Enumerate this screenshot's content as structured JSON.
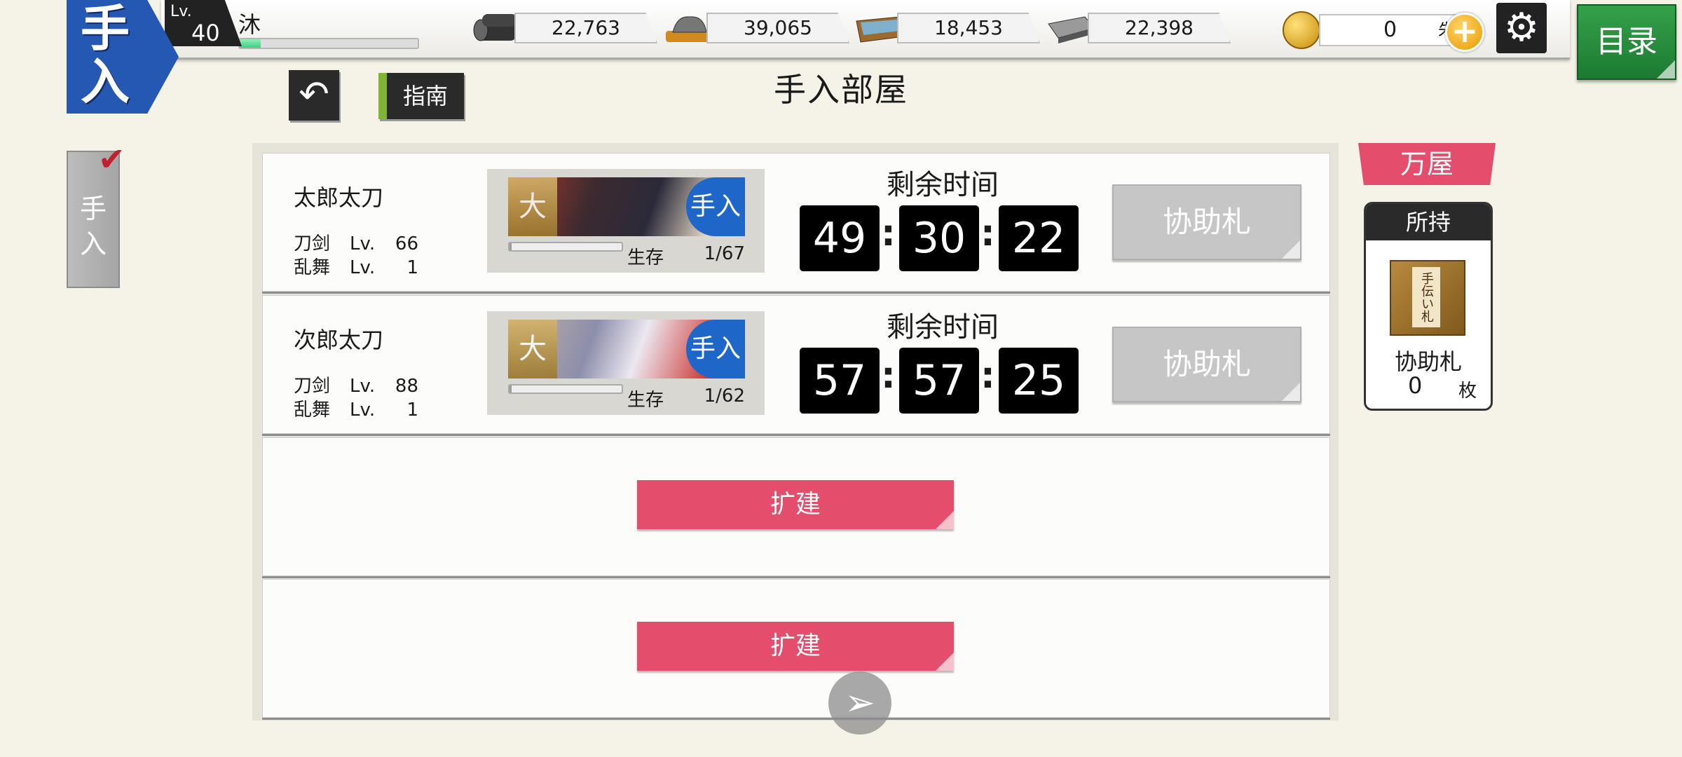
{
  "header": {
    "emblem_top": "手",
    "emblem_bottom": "入",
    "level_label": "Lv.",
    "level": "40",
    "player_name": "沐",
    "exp_progress": 0.12,
    "resources": [
      {
        "icon": "charcoal-icon",
        "value": "22,763"
      },
      {
        "icon": "tamahagane-icon",
        "value": "39,065"
      },
      {
        "icon": "coolant-icon",
        "value": "18,453"
      },
      {
        "icon": "whetstone-icon",
        "value": "22,398"
      }
    ],
    "currency": {
      "icon": "koban-coin-icon",
      "value": "0",
      "unit": "朱"
    },
    "settings_icon": "gear-icon",
    "menu_label": "目录"
  },
  "nav": {
    "back_icon": "undo-arrow-icon",
    "guide_label": "指南",
    "page_title": "手入部屋",
    "side_tab": [
      "手",
      "入"
    ]
  },
  "slots": [
    {
      "name": "太郎太刀",
      "stat1_key": "刀剑",
      "stat1_lv": "Lv.",
      "stat1_val": "66",
      "stat2_key": "乱舞",
      "stat2_lv": "Lv.",
      "stat2_val": "1",
      "badge_left": "大太",
      "badge_right": "手入",
      "status": "生存",
      "hp": "1/67",
      "hp_ratio": 0.015,
      "time_label": "剩余时间",
      "hours": "49",
      "minutes": "30",
      "seconds": "22",
      "help_label": "协助札"
    },
    {
      "name": "次郎太刀",
      "stat1_key": "刀剑",
      "stat1_lv": "Lv.",
      "stat1_val": "88",
      "stat2_key": "乱舞",
      "stat2_lv": "Lv.",
      "stat2_val": "1",
      "badge_left": "大太",
      "badge_right": "手入",
      "status": "生存",
      "hp": "1/62",
      "hp_ratio": 0.016,
      "time_label": "剩余时间",
      "hours": "57",
      "minutes": "57",
      "seconds": "25",
      "help_label": "协助札"
    }
  ],
  "expand_label": "扩建",
  "shop": {
    "tag": "万屋",
    "owned_title": "所持",
    "ticket_text": "手伝い札",
    "item_name": "协助札",
    "count": "0",
    "unit": "枚"
  }
}
